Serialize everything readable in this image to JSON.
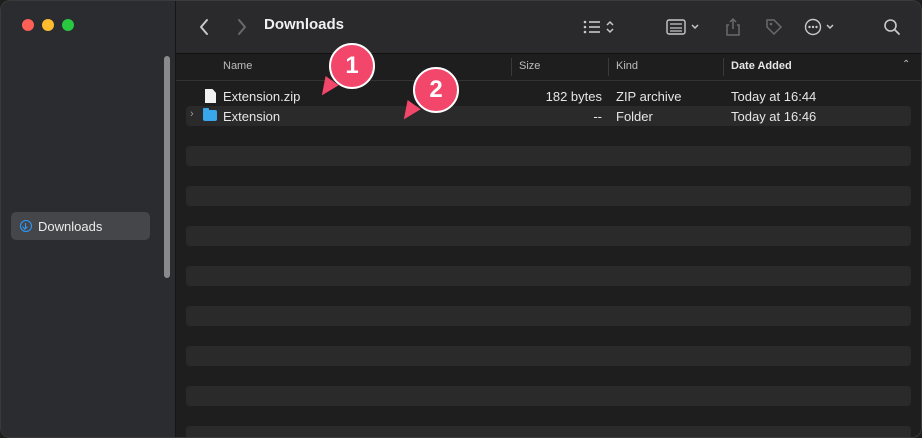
{
  "window": {
    "title": "Downloads"
  },
  "sidebar": {
    "items": [
      {
        "label": "Downloads",
        "icon": "download-circle-icon",
        "selected": true
      }
    ]
  },
  "toolbar": {
    "back_icon": "chevron-left-icon",
    "forward_icon": "chevron-right-icon",
    "view_list_icon": "list-view-icon",
    "view_grid_icon": "grid-view-icon",
    "share_icon": "share-icon",
    "tag_icon": "tag-icon",
    "more_icon": "ellipsis-circle-icon",
    "search_icon": "search-icon"
  },
  "columns": {
    "name": "Name",
    "size": "Size",
    "kind": "Kind",
    "date_added": "Date Added"
  },
  "files": [
    {
      "name": "Extension.zip",
      "size": "182 bytes",
      "kind": "ZIP archive",
      "date_added": "Today at 16:44",
      "type": "file"
    },
    {
      "name": "Extension",
      "size": "--",
      "kind": "Folder",
      "date_added": "Today at 16:46",
      "type": "folder"
    }
  ],
  "callouts": [
    {
      "number": "1"
    },
    {
      "number": "2"
    }
  ],
  "colors": {
    "accent": "#2f9bff",
    "callout": "#f2466b",
    "folder": "#39a6ec"
  }
}
